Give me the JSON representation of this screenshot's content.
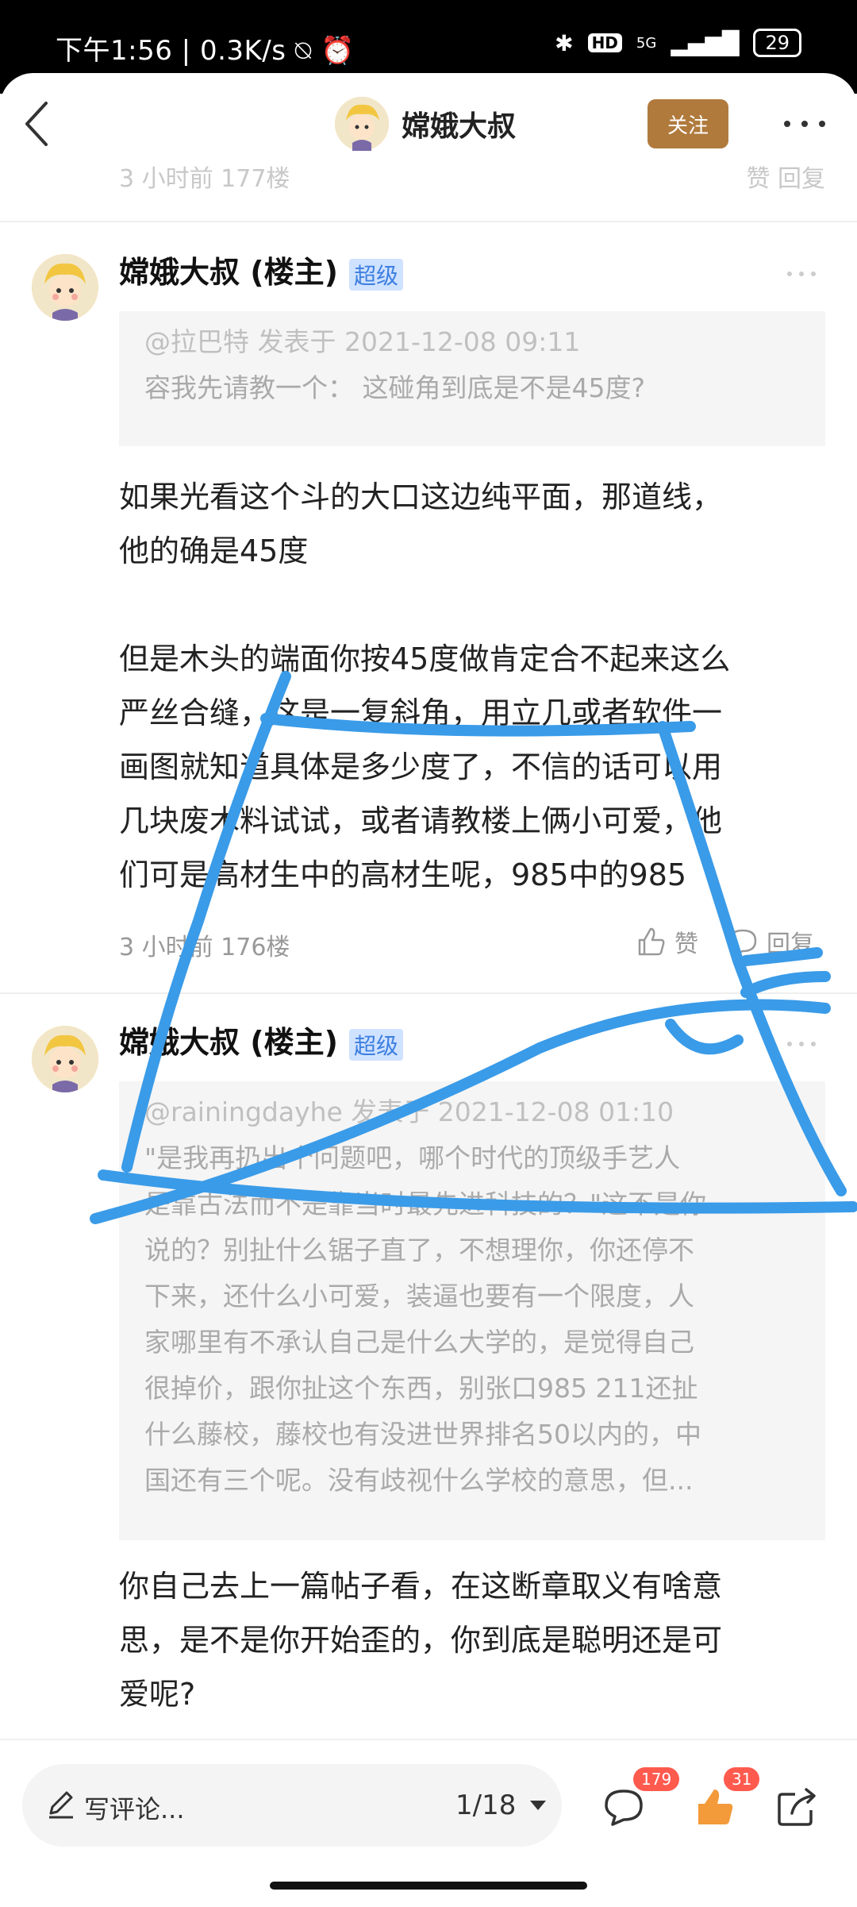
{
  "status_bar": {
    "time": "下午1:56",
    "net_speed": "0.3K/s",
    "signal": "5G",
    "hd": "HD",
    "battery": "29"
  },
  "header": {
    "title": "嫦娥大叔",
    "follow_label": "关注"
  },
  "cut_row": {
    "left_text": "3 小时前  177楼",
    "right_text": "赞    回复"
  },
  "posts": [
    {
      "author": "嫦娥大叔 (楼主)",
      "badge": "超级",
      "quote_header": "@拉巴特 发表于 2021-12-08 09:11",
      "quote_lines": [
        "容我先请教一个： 这碰角到底是不是45度?"
      ],
      "content_lines": [
        "如果光看这个斗的大口这边纯平面，那道线，",
        "他的确是45度",
        "",
        "但是木头的端面你按45度做肯定合不起来这么",
        "严丝合缝，这是一复斜角，用立几或者软件一",
        "画图就知道具体是多少度了，不信的话可以用",
        "几块废木料试试，或者请教楼上俩小可爱，他",
        "们可是高材生中的高材生呢，985中的985"
      ],
      "meta": "3 小时前  176楼",
      "like_label": "赞",
      "reply_label": "回复"
    },
    {
      "author": "嫦娥大叔 (楼主)",
      "badge": "超级",
      "quote_header": "@rainingdayhe 发表于 2021-12-08 01:10",
      "quote_lines": [
        "\"是我再扔出个问题吧，哪个时代的顶级手艺人",
        "是靠古法而不是靠当时最先进科技的？\"这不是你",
        "说的？别扯什么锯子直了，不想理你，你还停不",
        "下来，还什么小可爱，装逼也要有一个限度，人",
        "家哪里有不承认自己是什么大学的，是觉得自己",
        "很掉价，跟你扯这个东西，别张口985 211还扯",
        "什么藤校，藤校也有没进世界排名50以内的，中",
        "国还有三个呢。没有歧视什么学校的意思，但..."
      ],
      "content_lines": [
        "你自己去上一篇帖子看，在这断章取义有啥意",
        "思，是不是你开始歪的，你到底是聪明还是可",
        "爱呢?"
      ]
    }
  ],
  "bottom_bar": {
    "comment_placeholder": "写评论...",
    "page_indicator": "1/18",
    "comment_count": "179",
    "like_count": "31"
  },
  "colors": {
    "accent_follow": "#b07a3c",
    "badge_bg": "#cfe2ff",
    "badge_text": "#3d7fe0",
    "scribble": "#3a9be8",
    "count_badge": "#ff5a4e"
  },
  "icons": [
    "back-icon",
    "more-icon",
    "pen-icon",
    "caret-down-icon",
    "comment-icon",
    "like-icon",
    "share-icon",
    "thumb-up-icon",
    "reply-bubble-icon"
  ]
}
